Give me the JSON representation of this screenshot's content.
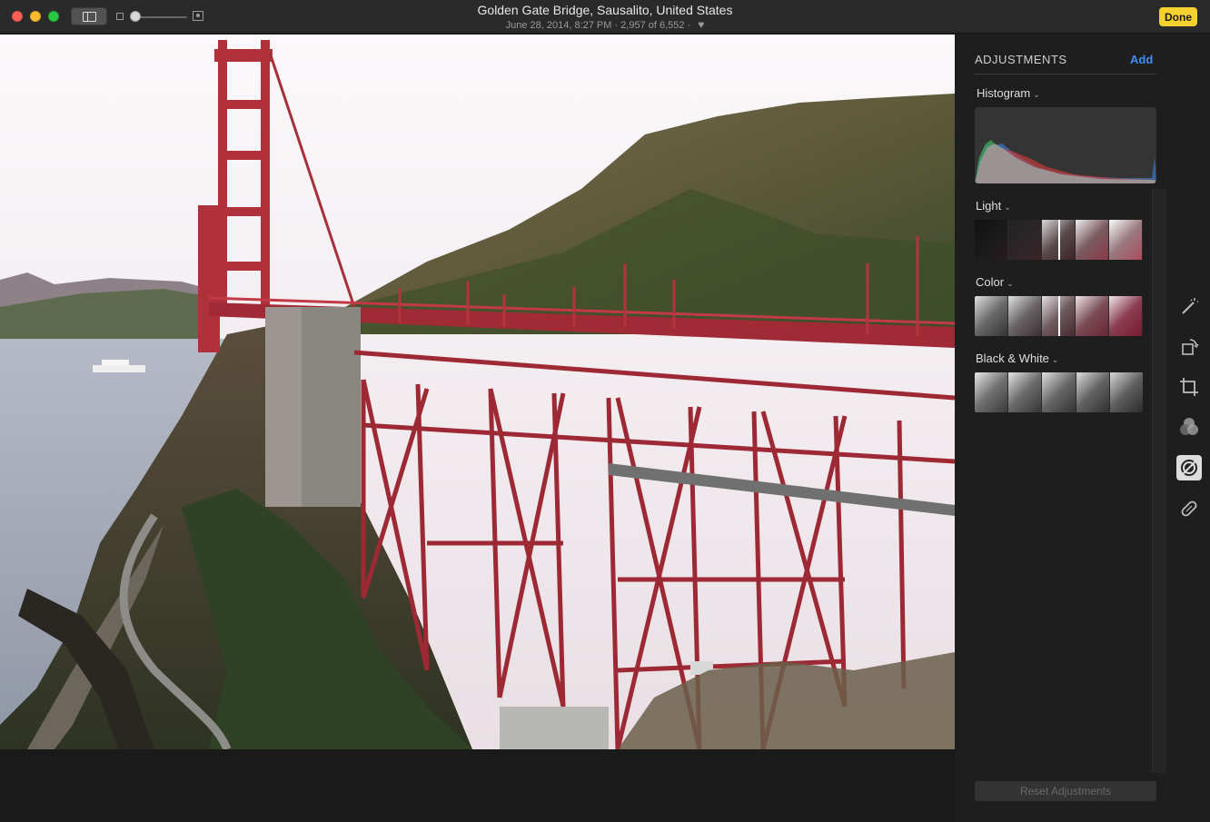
{
  "window": {
    "title": "Golden Gate Bridge, Sausalito, United States",
    "subtitle": "June 28, 2014, 8:27 PM  ·  2,957 of 6,552  ·",
    "done_label": "Done",
    "zoom_level": 0.0
  },
  "panel": {
    "title": "ADJUSTMENTS",
    "add_label": "Add",
    "sections": {
      "histogram": "Histogram",
      "light": "Light",
      "color": "Color",
      "black_white": "Black & White"
    },
    "reset_label": "Reset Adjustments"
  },
  "tools": [
    "magic-wand-icon",
    "rotate-icon",
    "crop-icon",
    "filters-icon",
    "adjust-icon",
    "retouch-icon"
  ],
  "colors": {
    "accent": "#3f8ef6",
    "done": "#f5d130",
    "bridge": "#b0313c"
  }
}
